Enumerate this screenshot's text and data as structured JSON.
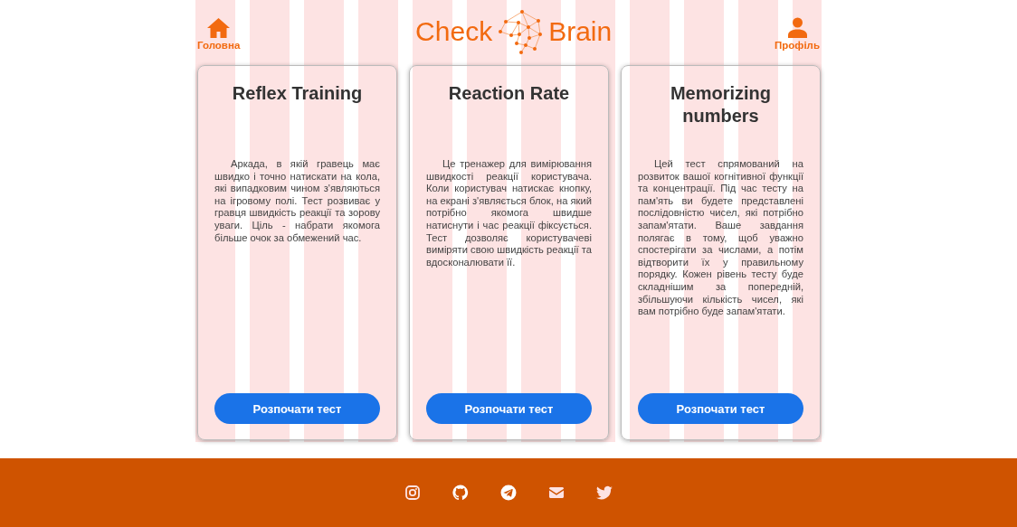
{
  "header": {
    "home_label": "Головна",
    "logo": {
      "left": "Check",
      "right": "Brain"
    },
    "profile_label": "Профіль"
  },
  "cards": [
    {
      "title": "Reflex Training",
      "text": "Аркада, в якій гравець має швидко і точно натискати на кола, які випадковим чином з'являються на ігровому полі. Тест розвиває у гравця швидкість реакції та зорову уваги. Ціль - набрати якомога більше очок за обмежений час.",
      "button": "Розпочати тест"
    },
    {
      "title": "Reaction Rate",
      "text": "Це тренажер для вимірювання швидкості реакції користувача. Коли користувач натискає кнопку, на екрані з'являється блок, на який потрібно якомога швидше натиснути і час реакції фіксується. Тест дозволяє користувачеві виміряти свою швидкість реакції та вдосконалювати її.",
      "button": "Розпочати тест"
    },
    {
      "title": "Memorizing numbers",
      "text": "Цей тест спрямований на розвиток вашої когнітивної функції та концентрації. Під час тесту на пам'ять ви будете представлені послідовністю чисел, які потрібно запам'ятати. Ваше завдання полягає в тому, щоб уважно спостерігати за числами, а потім відтворити їх у правильному порядку. Кожен рівень тесту буде складнішим за попередній, збільшуючи кількість чисел, які вам потрібно буде запам'ятати.",
      "button": "Розпочати тест"
    }
  ],
  "footer": {
    "links": [
      {
        "kind": "instagram"
      },
      {
        "kind": "github"
      },
      {
        "kind": "telegram"
      },
      {
        "kind": "mail"
      },
      {
        "kind": "twitter"
      }
    ]
  }
}
